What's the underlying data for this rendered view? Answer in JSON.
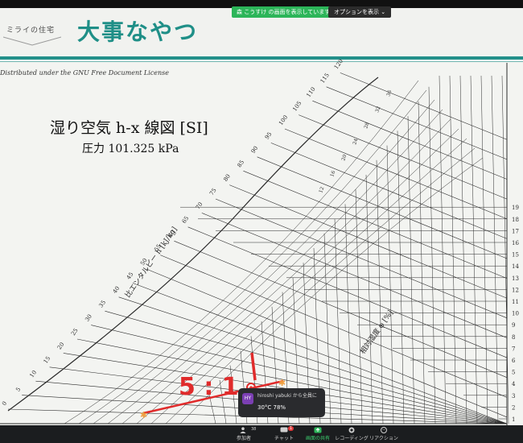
{
  "header": {
    "brand_label": "ミライの住宅",
    "title": "大事なやつ"
  },
  "zoom_bar": {
    "share_banner": "森 こうすけ の画面を表示しています",
    "options_label": "オプションを表示 ⌄"
  },
  "slide": {
    "license": "Distributed under the GNU Free Document License",
    "chart_title": "湿り空気 h-x 線図 [SI]",
    "chart_subtitle": "圧力 101.325 kPa",
    "enthalpy_axis_label": "比エンタルピー h [kJ/kg]",
    "rh_label": "相対湿度 φ [%]",
    "enthalpy_ticks": [
      "0",
      "5",
      "10",
      "15",
      "20",
      "25",
      "30",
      "35",
      "40",
      "45",
      "50",
      "55",
      "60",
      "65",
      "70",
      "75",
      "80",
      "85",
      "90",
      "95",
      "100",
      "105",
      "110",
      "115",
      "120"
    ],
    "right_ticks": [
      "1",
      "2",
      "3",
      "4",
      "5",
      "6",
      "7",
      "8",
      "9",
      "10",
      "11",
      "12",
      "13",
      "14",
      "15",
      "16",
      "17",
      "18",
      "19"
    ],
    "top_ticks": [
      "12",
      "16",
      "20",
      "24",
      "28",
      "32",
      "36"
    ],
    "annotation_ratio": "5 : 1"
  },
  "colors": {
    "teal": "#23908a",
    "annotation_red": "#e02b2b",
    "marker_orange": "#f0a040",
    "chart_ink": "#2b2b2b"
  },
  "toast": {
    "initials": "HY",
    "sender": "hiroshi yabuki から全員に",
    "message": "30°C  78%"
  },
  "toolbar": {
    "participants_label": "参加者",
    "participants_count": "38",
    "chat_label": "チャット",
    "chat_badge": "1",
    "share_label": "画面の共有",
    "record_label": "レコーディング",
    "reaction_label": "リアクション"
  }
}
